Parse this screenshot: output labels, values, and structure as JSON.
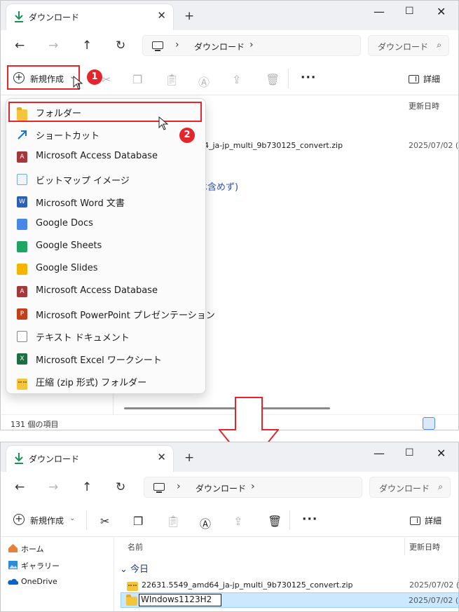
{
  "top_window": {
    "tab_title": "ダウンロード",
    "address": {
      "location": "ダウンロード"
    },
    "search": {
      "placeholder": "ダウンロード"
    },
    "toolbar": {
      "new_label": "新規作成",
      "details_label": "詳細"
    },
    "columns": {
      "date": "更新日時"
    },
    "files": [
      {
        "name": "4_ja-jp_multi_9b730125_convert.zip",
        "date": "2025/07/02 ("
      }
    ],
    "partial_text": "は含めず)",
    "status": "131 個の項目",
    "markers": [
      "1",
      "2"
    ]
  },
  "new_menu": {
    "items": [
      {
        "label": "フォルダー",
        "icon": "folder-icon"
      },
      {
        "label": "ショートカット",
        "icon": "shortcut-icon"
      },
      {
        "label": "Microsoft Access Database",
        "icon": "access-icon"
      },
      {
        "label": "ビットマップ イメージ",
        "icon": "bitmap-icon"
      },
      {
        "label": "Microsoft Word 文書",
        "icon": "word-icon"
      },
      {
        "label": "Google Docs",
        "icon": "google-docs-icon"
      },
      {
        "label": "Google Sheets",
        "icon": "google-sheets-icon"
      },
      {
        "label": "Google Slides",
        "icon": "google-slides-icon"
      },
      {
        "label": "Microsoft Access Database",
        "icon": "access-icon"
      },
      {
        "label": "Microsoft PowerPoint プレゼンテーション",
        "icon": "powerpoint-icon"
      },
      {
        "label": "テキスト ドキュメント",
        "icon": "text-document-icon"
      },
      {
        "label": "Microsoft Excel ワークシート",
        "icon": "excel-icon"
      },
      {
        "label": "圧縮 (zip 形式) フォルダー",
        "icon": "zip-folder-icon"
      }
    ]
  },
  "bottom_window": {
    "tab_title": "ダウンロード",
    "address": {
      "location": "ダウンロード"
    },
    "search": {
      "placeholder": "ダウンロード"
    },
    "toolbar": {
      "new_label": "新規作成",
      "details_label": "詳細"
    },
    "columns": {
      "name": "名前",
      "date": "更新日時"
    },
    "group": "今日",
    "sidebar": [
      {
        "label": "ホーム",
        "icon": "home-icon"
      },
      {
        "label": "ギャラリー",
        "icon": "gallery-icon"
      },
      {
        "label": "OneDrive",
        "icon": "onedrive-icon"
      }
    ],
    "files": [
      {
        "name": "22631.5549_amd64_ja-jp_multi_9b730125_convert.zip",
        "date": "2025/07/02 ("
      }
    ],
    "rename_value": "WIndows1123H2",
    "rename_date": "2025/07/02 ("
  },
  "colors": {
    "accent_red": "#e4262c",
    "selection": "#cce8ff",
    "folder": "#f4c43a"
  }
}
